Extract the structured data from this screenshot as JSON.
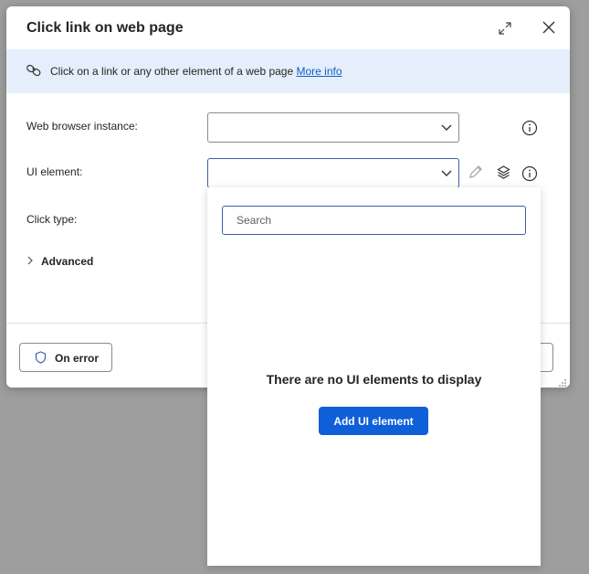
{
  "dialog": {
    "title": "Click link on web page",
    "description": "Click on a link or any other element of a web page",
    "more_info": "More info"
  },
  "fields": {
    "browser_label": "Web browser instance:",
    "browser_value": "",
    "ui_element_label": "UI element:",
    "ui_element_value": "",
    "click_type_label": "Click type:",
    "advanced_label": "Advanced"
  },
  "footer": {
    "on_error_label": "On error"
  },
  "ui_element_picker": {
    "search_placeholder": "Search",
    "empty_message": "There are no UI elements to display",
    "add_button_label": "Add UI element"
  },
  "icons": {
    "title_actions": [
      "expand-icon",
      "close-icon"
    ],
    "banner": "link-icon",
    "field_actions": [
      "info-icon",
      "pencil-icon",
      "layers-icon"
    ],
    "on_error": "shield-icon",
    "advanced": "chevron-right-icon"
  },
  "colors": {
    "accent": "#0f5fd9",
    "banner_bg": "#e6eefb",
    "link": "#0f5fc4",
    "backdrop": "#9e9e9e"
  }
}
